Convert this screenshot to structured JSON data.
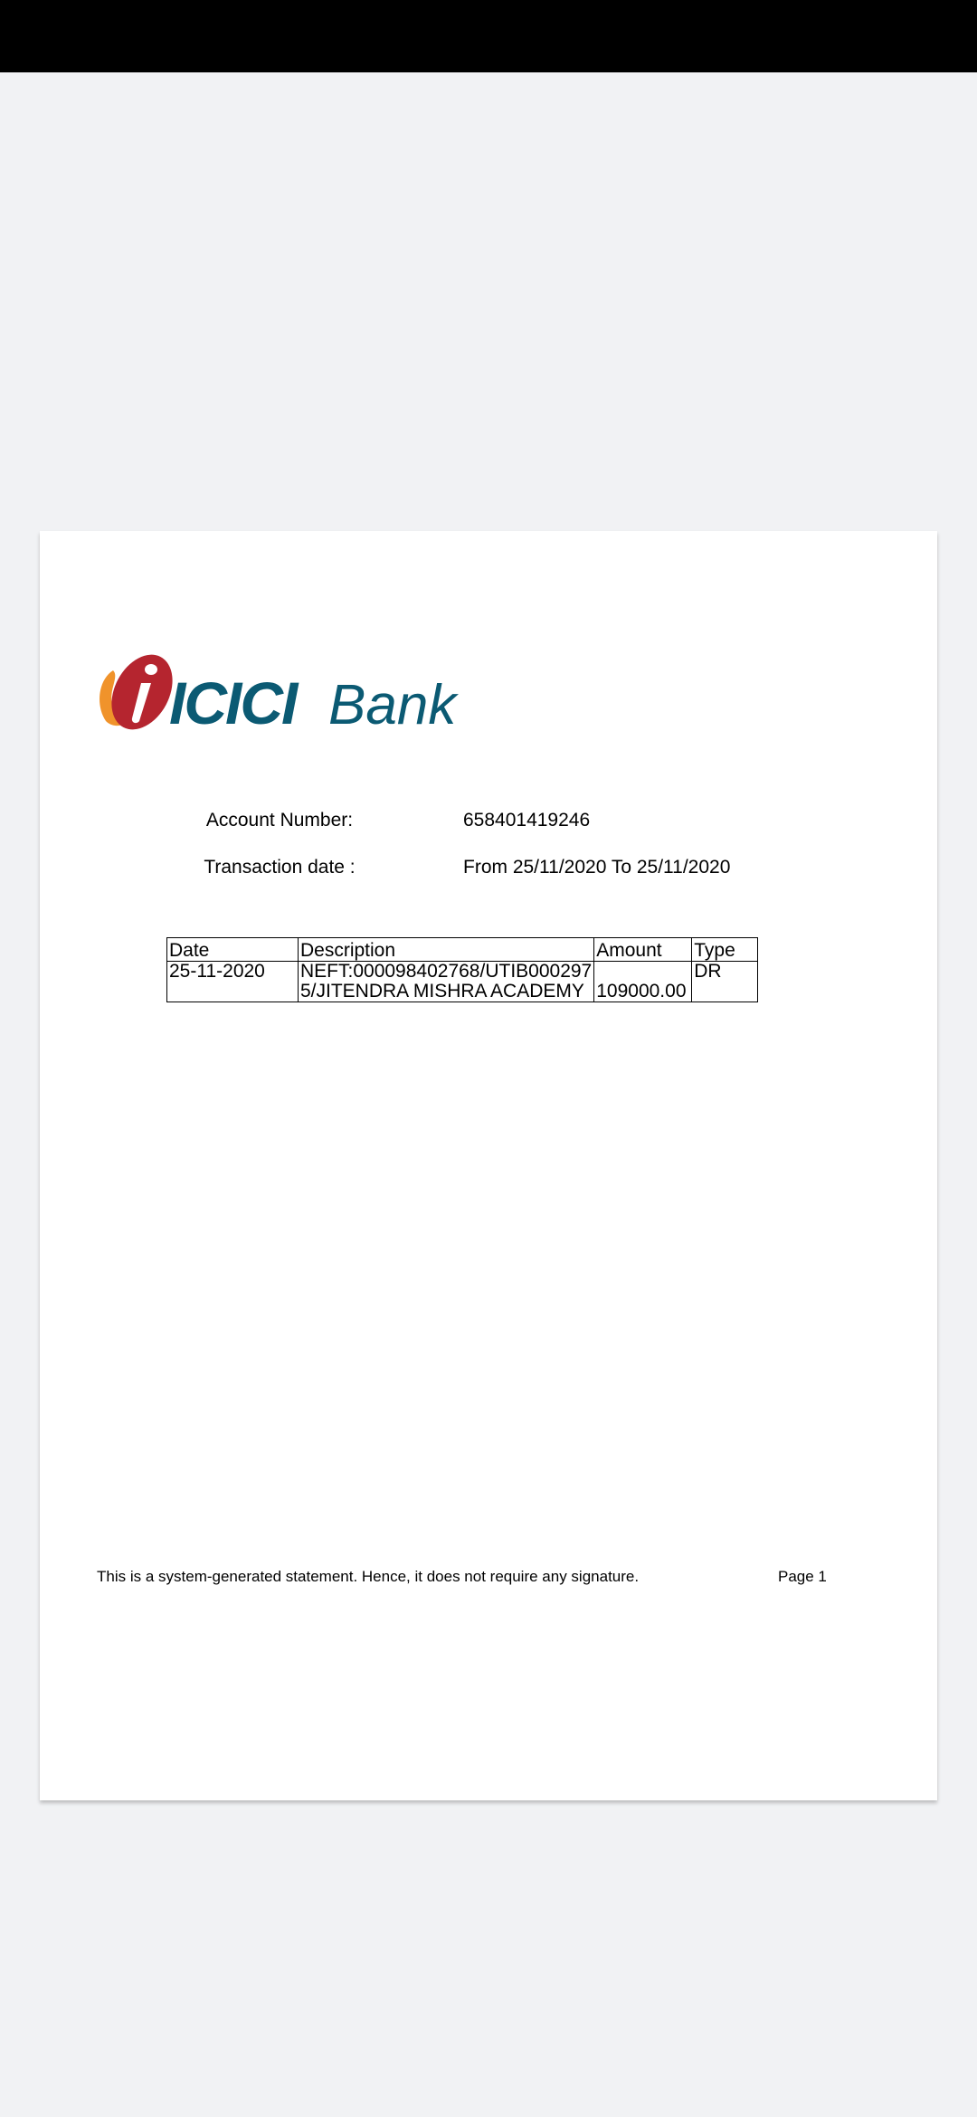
{
  "document": {
    "logo_text": "ICICI Bank",
    "account": {
      "label": "Account Number:",
      "value": "658401419246"
    },
    "transaction_date": {
      "label": "Transaction date :",
      "value": "From 25/11/2020 To 25/11/2020"
    },
    "table": {
      "headers": [
        "Date",
        "Description",
        "Amount",
        "Type"
      ],
      "rows": [
        {
          "date": "25-11-2020",
          "description_line1": "NEFT:000098402768/UTIB000297",
          "description_line2": "5/JITENDRA MISHRA ACADEMY",
          "amount": "109000.00",
          "type": "DR"
        }
      ]
    },
    "footer": {
      "note": "This is a system-generated statement. Hence, it does not require any signature.",
      "page": "Page 1"
    }
  },
  "colors": {
    "logo_teal": "#0b5a73",
    "logo_red": "#b5252f",
    "logo_orange": "#f0932b",
    "page_bg": "#f1f2f4"
  }
}
